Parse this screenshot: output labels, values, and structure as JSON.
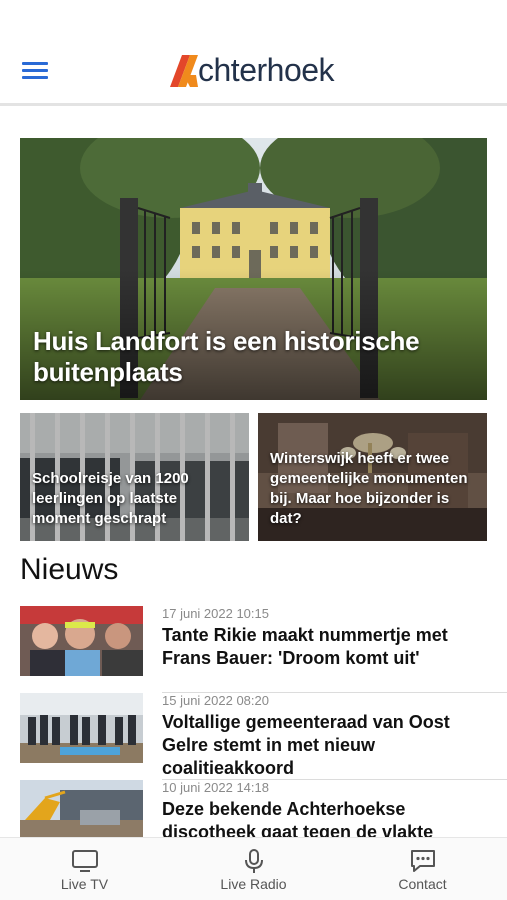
{
  "header": {
    "menu_icon": "hamburger-icon",
    "logo_text": "chterhoek",
    "brand_colors": {
      "primary": "#23324a",
      "accent_orange": "#f08a1c",
      "accent_red": "#e3472a",
      "menu_blue": "#2a6ad6"
    }
  },
  "hero": {
    "title": "Huis Landfort is een historische buitenplaats"
  },
  "cards": [
    {
      "title": "Schoolreisje van 1200 leerlingen op laatste moment geschrapt"
    },
    {
      "title": "Winterswijk heeft er twee gemeentelijke monumenten bij. Maar hoe bijzonder is dat?"
    }
  ],
  "section": {
    "title": "Nieuws"
  },
  "news": [
    {
      "date": "17 juni 2022 10:15",
      "headline": "Tante Rikie maakt nummertje met Frans Bauer: 'Droom komt uit'"
    },
    {
      "date": "15 juni 2022 08:20",
      "headline": "Voltallige gemeenteraad van Oost Gelre stemt in met nieuw coalitieakkoord"
    },
    {
      "date": "10 juni 2022 14:18",
      "headline": "Deze bekende Achterhoekse discotheek gaat tegen de vlakte"
    }
  ],
  "bottom_nav": [
    {
      "label": "Live TV",
      "icon": "tv-icon"
    },
    {
      "label": "Live Radio",
      "icon": "microphone-icon"
    },
    {
      "label": "Contact",
      "icon": "chat-bubble-icon"
    }
  ]
}
